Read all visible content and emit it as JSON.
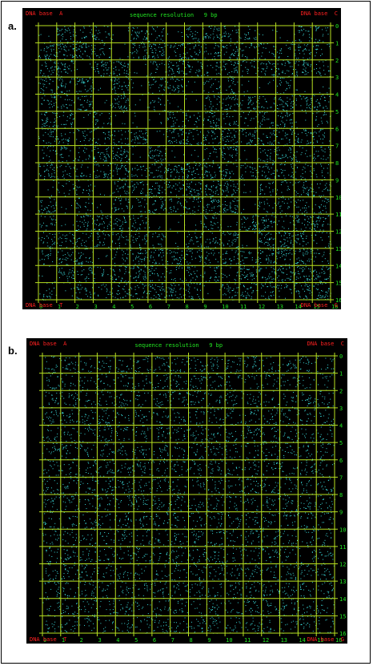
{
  "colors": {
    "background": "#000000",
    "grid": "#b8e020",
    "dots": "#3ad8d8",
    "corner_text": "#ff2020",
    "axis_text": "#22e822"
  },
  "panels": [
    {
      "label": "a.",
      "title": "sequence resolution   9 bp",
      "corner_top_left": "DNA base  A",
      "corner_top_right": "DNA base  C",
      "corner_bottom_left": "DNA base  T",
      "corner_bottom_right": "DNA base  G",
      "x_ticks": [
        "0",
        "1",
        "2",
        "3",
        "4",
        "5",
        "6",
        "7",
        "8",
        "9",
        "10",
        "11",
        "12",
        "13",
        "14",
        "15",
        "16"
      ],
      "y_ticks": [
        "0",
        "1",
        "2",
        "3",
        "4",
        "5",
        "6",
        "7",
        "8",
        "9",
        "10",
        "11",
        "12",
        "13",
        "14",
        "15",
        "16"
      ],
      "pattern": "structured"
    },
    {
      "label": "b.",
      "title": "sequence resolution   9 bp",
      "corner_top_left": "DNA base  A",
      "corner_top_right": "DNA base  C",
      "corner_bottom_left": "DNA base  T",
      "corner_bottom_right": "DNA base  G",
      "x_ticks": [
        "0",
        "1",
        "2",
        "3",
        "4",
        "5",
        "6",
        "7",
        "8",
        "9",
        "10",
        "11",
        "12",
        "13",
        "14",
        "15",
        "16"
      ],
      "y_ticks": [
        "0",
        "1",
        "2",
        "3",
        "4",
        "5",
        "6",
        "7",
        "8",
        "9",
        "10",
        "11",
        "12",
        "13",
        "14",
        "15",
        "16"
      ],
      "pattern": "uniform"
    }
  ]
}
